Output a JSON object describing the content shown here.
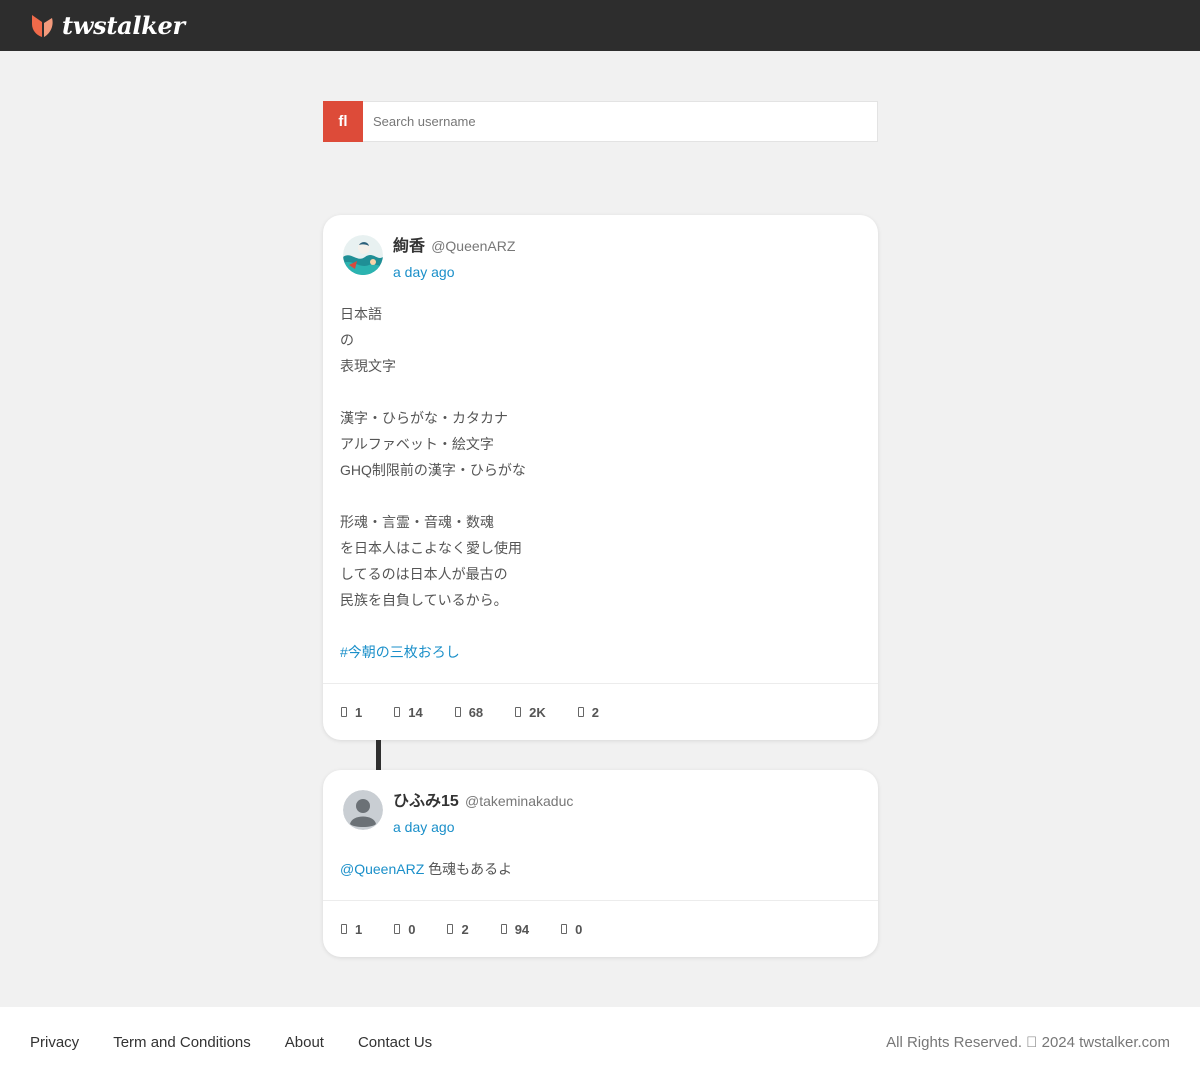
{
  "header": {
    "brand": "twstalker",
    "logo_icon": "twstalker-logo-icon",
    "brand_color": "#f06a4a"
  },
  "search": {
    "button_icon": "search-icon",
    "button_glyph": "fl",
    "placeholder": "Search username",
    "value": ""
  },
  "tweets": [
    {
      "display_name": "絢香",
      "handle": "@QueenARZ",
      "time": "a day ago",
      "lines": [
        "日本語",
        "の",
        "表現文字",
        "",
        "漢字・ひらがな・カタカナ",
        "アルファベット・絵文字",
        "GHQ制限前の漢字・ひらがな",
        "",
        "形魂・言霊・音魂・数魂",
        "を日本人はこよなく愛し使用",
        "してるのは日本人が最古の",
        "民族を自負しているから。",
        ""
      ],
      "hashtag": "#今朝の三枚おろし",
      "stats": [
        {
          "icon": "reply-icon",
          "value": "1"
        },
        {
          "icon": "retweet-icon",
          "value": "14"
        },
        {
          "icon": "like-icon",
          "value": "68"
        },
        {
          "icon": "views-icon",
          "value": "2K"
        },
        {
          "icon": "bookmark-icon",
          "value": "2"
        }
      ]
    },
    {
      "display_name": "ひふみ15",
      "handle": "@takeminakaduc",
      "time": "a day ago",
      "mention": "@QueenARZ",
      "text": " 色魂もあるよ",
      "stats": [
        {
          "icon": "reply-icon",
          "value": "1"
        },
        {
          "icon": "retweet-icon",
          "value": "0"
        },
        {
          "icon": "like-icon",
          "value": "2"
        },
        {
          "icon": "views-icon",
          "value": "94"
        },
        {
          "icon": "bookmark-icon",
          "value": "0"
        }
      ]
    }
  ],
  "footer": {
    "links": [
      "Privacy",
      "Term and Conditions",
      "About",
      "Contact Us"
    ],
    "copyright": "All Rights Reserved. \u0000 2024 twstalker.com"
  },
  "colors": {
    "header_bg": "#2d2d2d",
    "accent_red": "#dd4b39",
    "link_blue": "#1a8fc9",
    "page_bg": "#f1f1f1"
  }
}
